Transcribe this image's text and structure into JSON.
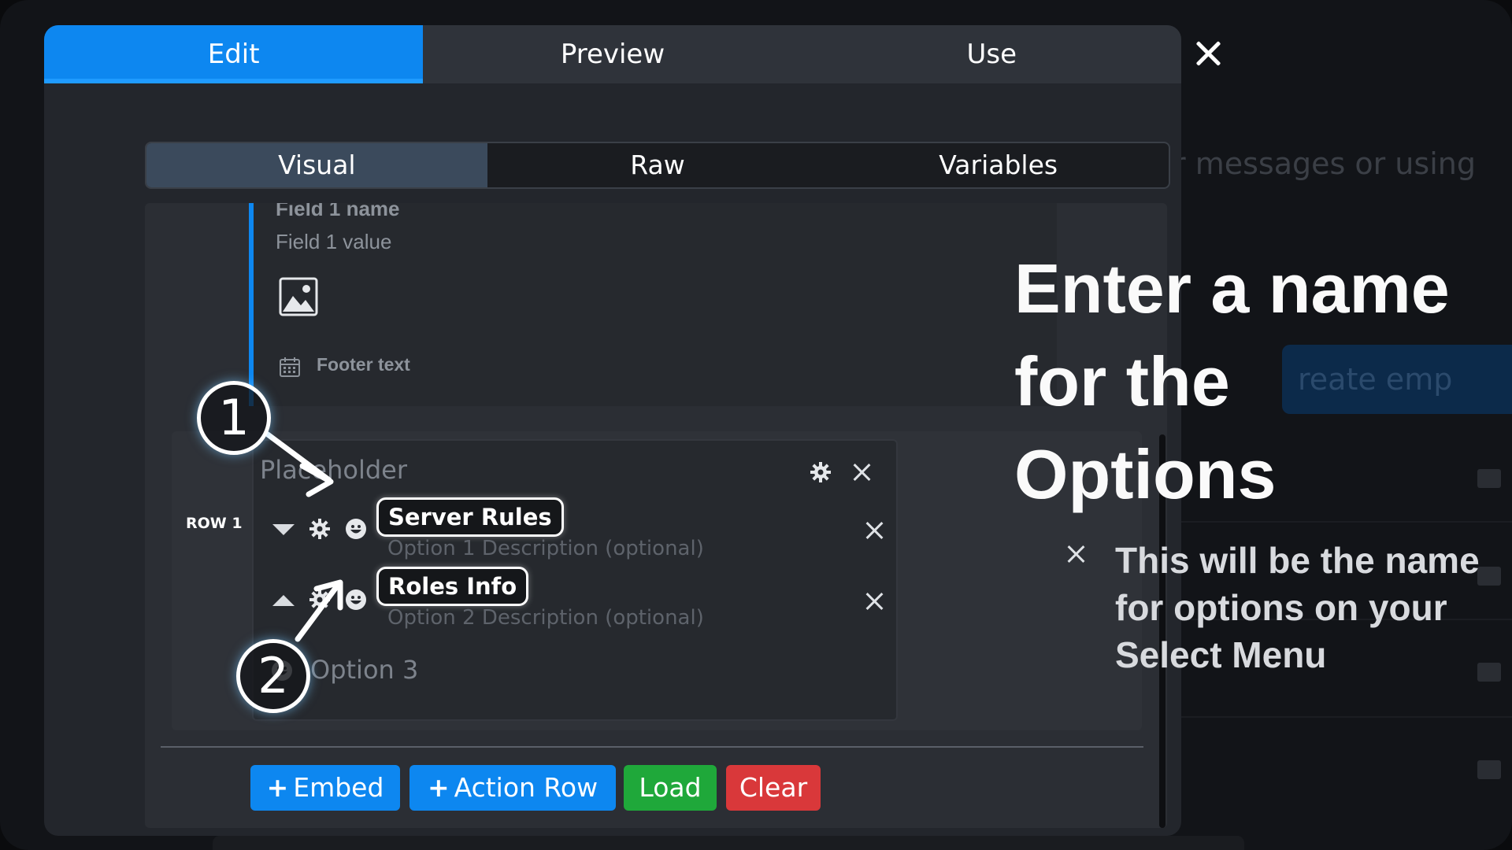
{
  "background": {
    "text_fragment": "r messages or using",
    "button_fragment": "reate emp"
  },
  "tabs": [
    {
      "label": "Edit",
      "active": true
    },
    {
      "label": "Preview",
      "active": false
    },
    {
      "label": "Use",
      "active": false
    }
  ],
  "subtabs": [
    {
      "label": "Visual",
      "active": true
    },
    {
      "label": "Raw",
      "active": false
    },
    {
      "label": "Variables",
      "active": false
    }
  ],
  "embed": {
    "field_name": "Field 1 name",
    "field_value": "Field 1 value",
    "footer_text": "Footer text"
  },
  "action_row": {
    "label": "ROW 1",
    "placeholder": "Placeholder",
    "options": [
      {
        "name": "Server Rules",
        "description": "Option 1 Description (optional)"
      },
      {
        "name": "Roles Info",
        "description": "Option 2 Description (optional)"
      }
    ],
    "new_option": "Option 3"
  },
  "buttons": {
    "embed": "Embed",
    "action_row": "Action Row",
    "load": "Load",
    "clear": "Clear"
  },
  "callout": {
    "title": "Enter a name for the Options",
    "subtitle": "This will be the name for options on your Select Menu",
    "markers": [
      "1",
      "2"
    ]
  },
  "colors": {
    "accent": "#0d87f0",
    "load": "#1fa83a",
    "clear": "#d9383a"
  }
}
